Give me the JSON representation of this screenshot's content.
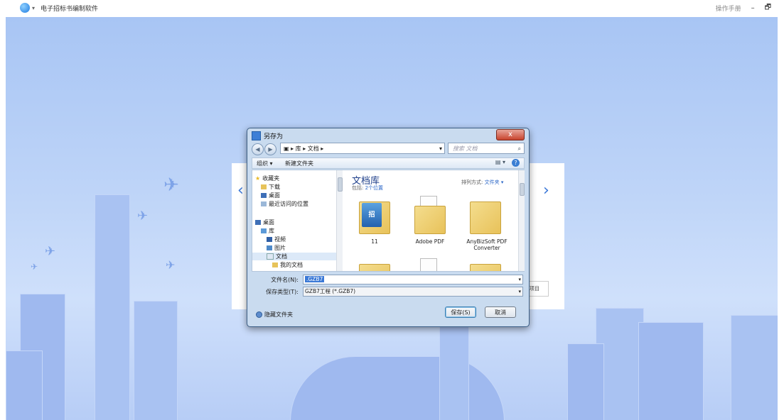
{
  "app": {
    "title": "电子招标书编制软件",
    "manual": "操作手册",
    "minimize": "–",
    "restore": "🗗"
  },
  "dialog": {
    "title": "另存为",
    "close": "x",
    "address": {
      "path": "▣ ▸ 库 ▸ 文档 ▸",
      "search_placeholder": "搜索 文档"
    },
    "toolbar": {
      "organize": "组织 ▾",
      "new_folder": "新建文件夹"
    },
    "nav": [
      {
        "label": "收藏夹"
      },
      {
        "label": "下载"
      },
      {
        "label": "桌面"
      },
      {
        "label": "最近访问的位置"
      },
      {
        "label": "桌面"
      },
      {
        "label": "库"
      },
      {
        "label": "视频"
      },
      {
        "label": "图片"
      },
      {
        "label": "文档"
      },
      {
        "label": "我的文档"
      }
    ],
    "library": {
      "title": "文档库",
      "includes": "包括:",
      "locations": "2个位置",
      "arrange_label": "排列方式:",
      "arrange_value": "文件夹 ▾"
    },
    "folders": [
      {
        "name": "11",
        "overlay": "招"
      },
      {
        "name": "Adobe PDF"
      },
      {
        "name": "AnyBizSoft PDF Converter"
      }
    ],
    "filename": {
      "label": "文件名(N):",
      "value": ".GZB7"
    },
    "filetype": {
      "label": "保存类型(T):",
      "value": "GZB7工程 (*.GZB7)"
    },
    "hide_folders": "隐藏文件夹",
    "save": "保存(S)",
    "cancel": "取消"
  },
  "panel": {
    "left_arrow": "‹",
    "right_arrow": "›",
    "fragment": "项目"
  }
}
